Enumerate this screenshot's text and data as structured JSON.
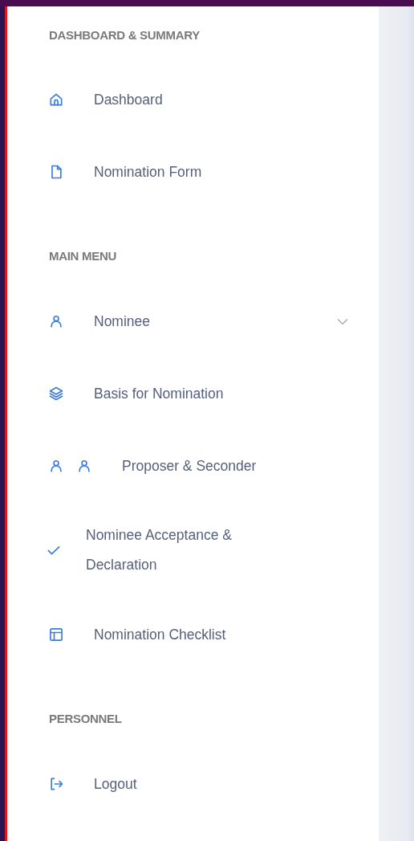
{
  "sections": [
    {
      "title": "DASHBOARD & SUMMARY",
      "items": [
        {
          "kind": "home",
          "label": "Dashboard"
        },
        {
          "kind": "document",
          "label": "Nomination Form"
        }
      ]
    },
    {
      "title": "MAIN MENU",
      "items": [
        {
          "kind": "person",
          "label": "Nominee",
          "expanded": false
        },
        {
          "kind": "layers",
          "label": "Basis for Nomination"
        },
        {
          "kind": "people",
          "label": "Proposer & Seconder"
        },
        {
          "kind": "check",
          "label": "Nominee Acceptance & Declaration"
        },
        {
          "kind": "layout",
          "label": "Nomination Checklist"
        }
      ]
    },
    {
      "title": "PERSONNEL",
      "items": [
        {
          "kind": "logout",
          "label": "Logout"
        }
      ]
    }
  ]
}
